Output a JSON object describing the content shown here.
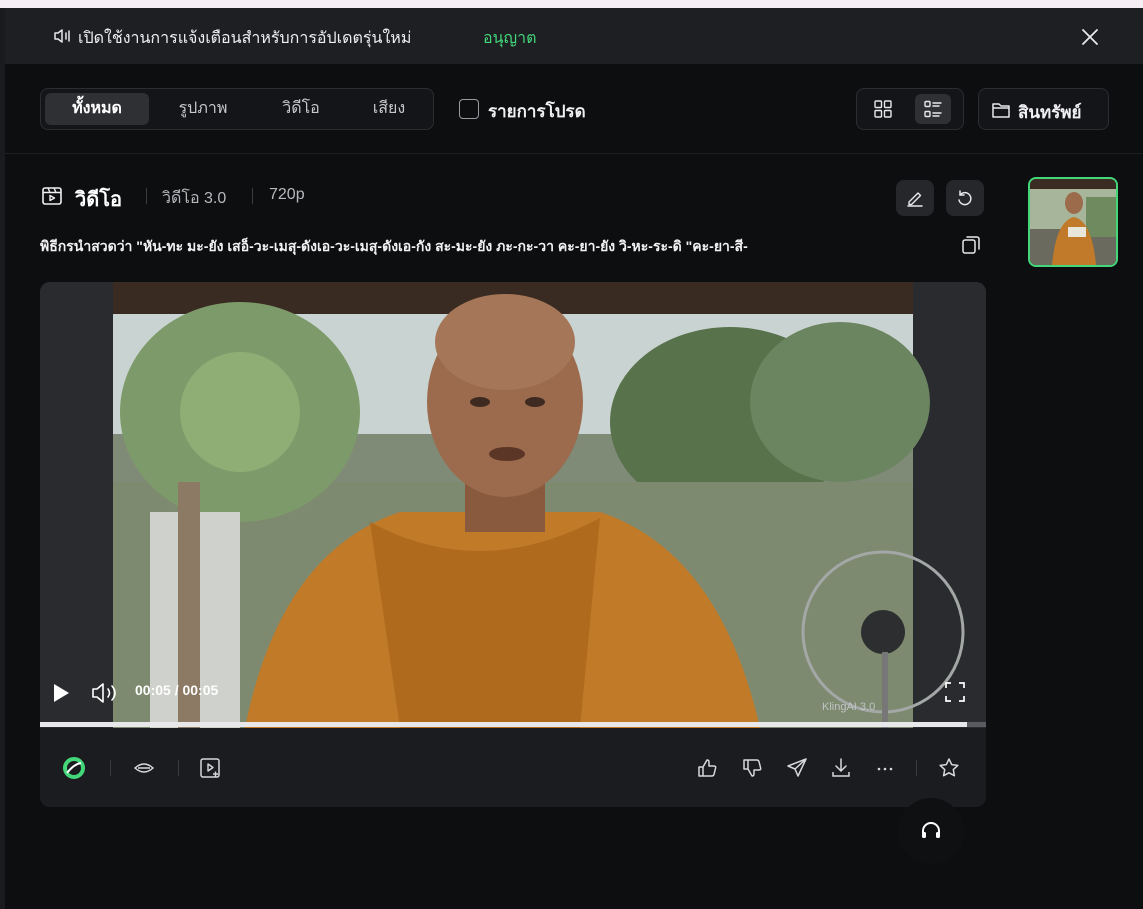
{
  "notification": {
    "text": "เปิดใช้งานการแจ้งเตือนสำหรับการอัปเดตรุ่นใหม่",
    "action": "อนุญาต"
  },
  "filters": {
    "tabs": [
      {
        "label": "ทั้งหมด",
        "active": true
      },
      {
        "label": "รูปภาพ",
        "active": false
      },
      {
        "label": "วิดีโอ",
        "active": false
      },
      {
        "label": "เสียง",
        "active": false
      }
    ],
    "favorites_label": "รายการโปรด",
    "favorites_checked": false
  },
  "view_toggle": {
    "grid_icon": "grid-icon",
    "list_icon": "list-icon",
    "active": "list"
  },
  "assets_button": {
    "label": "สินทรัพย์",
    "icon": "folder-icon"
  },
  "card": {
    "type_label": "วิดีโอ",
    "model": "วิดีโอ 3.0",
    "resolution": "720p",
    "prompt": "พิธีกรนำสวดว่า \"หัน-ทะ มะ-ยัง เสอ็-วะ-เมสุ-ดังเอ-วะ-เมสุ-ดังเอ-กัง สะ-มะ-ยัง ภะ-กะ-วา คะ-ยา-ยัง วิ-หะ-ระ-ดิ \"คะ-ยา-สี-"
  },
  "player": {
    "time": "00:05 / 00:05",
    "progress": 0.98,
    "watermark": "KlingAI 3.0"
  },
  "colors": {
    "accent": "#43d77a",
    "background": "#0d0e10",
    "panel": "#1b1c1f"
  }
}
